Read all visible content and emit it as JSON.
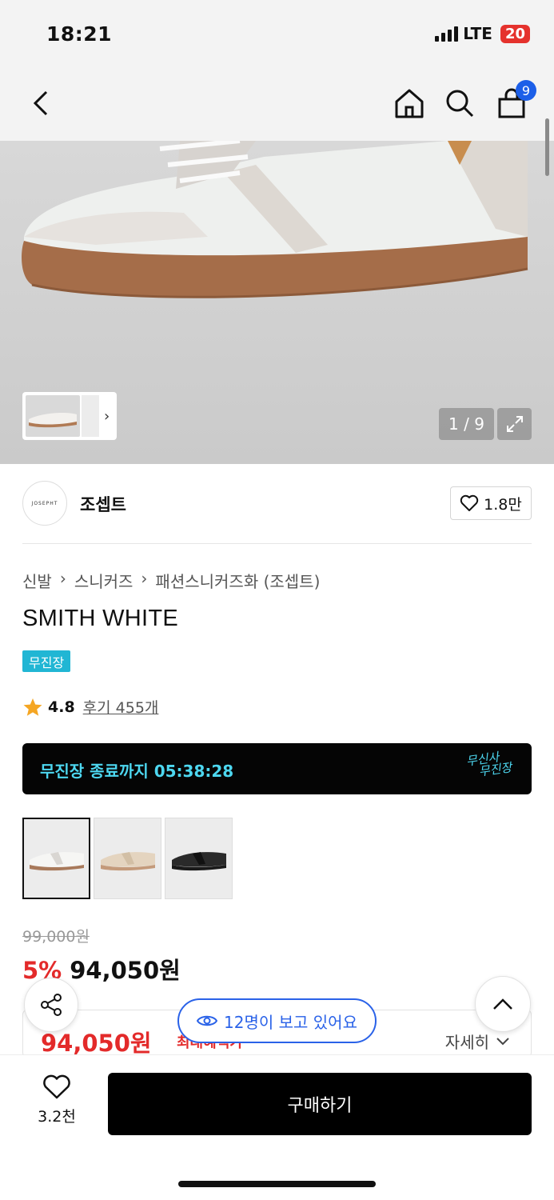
{
  "status": {
    "time": "18:21",
    "network": "LTE",
    "battery": "20"
  },
  "header": {
    "cart_count": "9"
  },
  "gallery": {
    "page_indicator": "1 / 9",
    "thumb_arrow": "›"
  },
  "brand": {
    "logo_text": "JOSEPHT",
    "name": "조셉트",
    "likes": "1.8만"
  },
  "breadcrumb": [
    "신발",
    "스니커즈",
    "패션스니커즈화 (조셉트)"
  ],
  "product": {
    "title": "SMITH WHITE",
    "badge": "무진장",
    "rating": "4.8",
    "reviews": "후기 455개"
  },
  "timer": {
    "text": "무진장 종료까지 05:38:28",
    "logo_line1": "무신사",
    "logo_line2": "무진장"
  },
  "swatches": [
    {
      "name": "white",
      "sole": "#a8795a",
      "upper": "#f4f4f2"
    },
    {
      "name": "beige",
      "sole": "#c49a7a",
      "upper": "#e4d4bf"
    },
    {
      "name": "black",
      "sole": "#1a1a1a",
      "upper": "#2a2a2a"
    }
  ],
  "price": {
    "original": "99,000원",
    "discount": "5%",
    "sale": "94,050원",
    "promo_price": "94,050원",
    "promo_max": "최대혜택가",
    "detail": "자세히"
  },
  "floating": {
    "viewers": "12명이 보고 있어요"
  },
  "bottom": {
    "wish_count": "3.2천",
    "buy": "구매하기"
  }
}
